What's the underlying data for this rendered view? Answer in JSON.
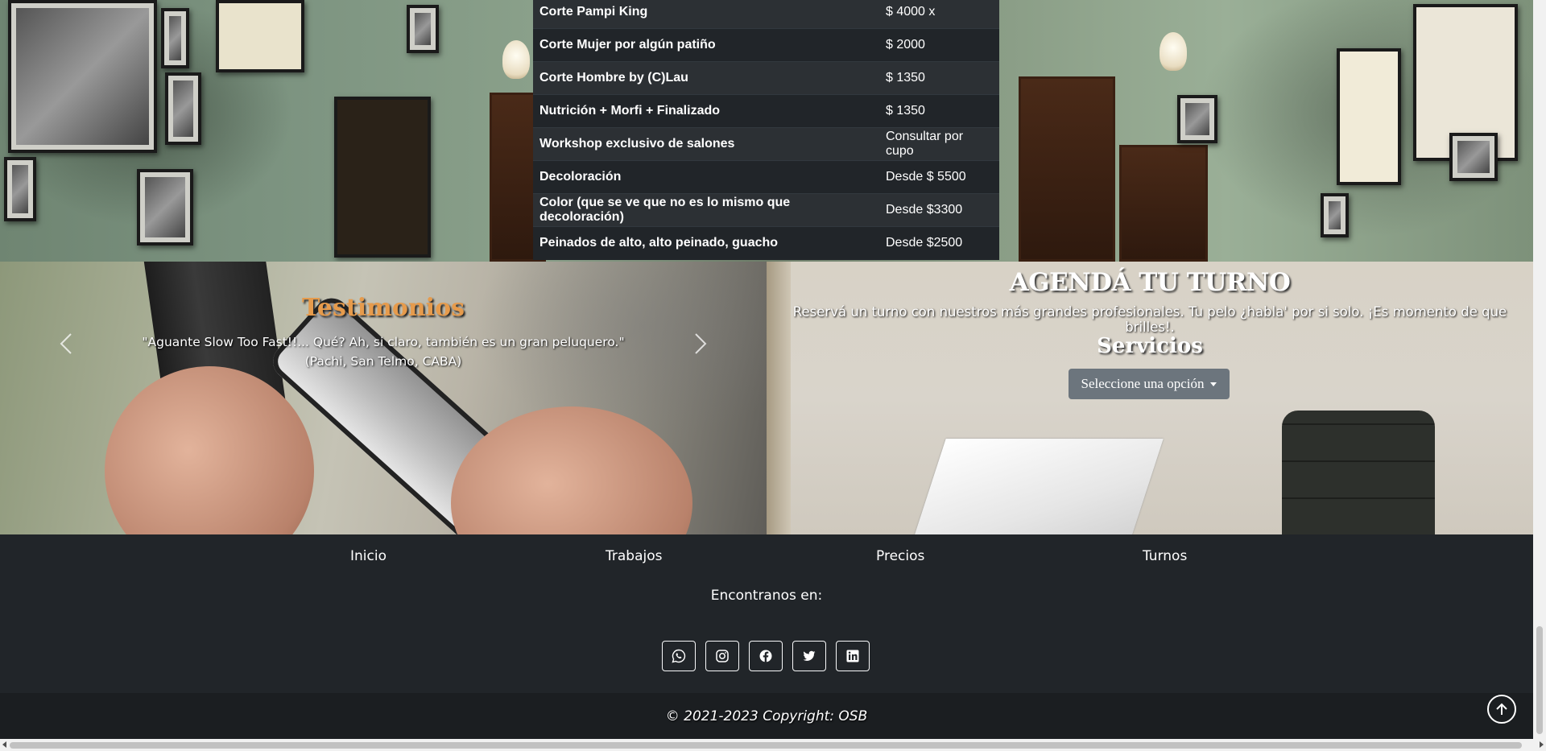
{
  "prices": {
    "rows": [
      {
        "name": "Corte Pampi King",
        "price": "$ 4000 x"
      },
      {
        "name": "Corte Mujer por algún patiño",
        "price": "$ 2000"
      },
      {
        "name": "Corte Hombre by (C)Lau",
        "price": "$ 1350"
      },
      {
        "name": "Nutrición + Morfi + Finalizado",
        "price": "$ 1350"
      },
      {
        "name": "Workshop exclusivo de salones",
        "price": "Consultar por cupo"
      },
      {
        "name": "Decoloración",
        "price": "Desde $ 5500"
      },
      {
        "name": "Color (que se ve que no es lo mismo que decoloración)",
        "price": "Desde $3300"
      },
      {
        "name": "Peinados de alto, alto peinado, guacho",
        "price": "Desde $2500"
      }
    ]
  },
  "testimonials": {
    "title": "Testimonios",
    "quote": "\"Aguante Slow Too Fast!!... Qué? Ah, si claro, también es un gran peluquero.\"",
    "author": "(Pachi, San Telmo, CABA)",
    "prev_icon": "chevron-left-icon",
    "next_icon": "chevron-right-icon",
    "title_color": "#e69b4c"
  },
  "booking": {
    "title": "AGENDÁ TU TURNO",
    "text": "Reservá un turno con nuestros más grandes profesionales. Tu pelo ¿habla' por si solo. ¡Es momento de que brilles!.",
    "services_title": "Servicios",
    "select_label": "Seleccione una opción",
    "select_color": "#6c757d"
  },
  "footer": {
    "nav": [
      "Inicio",
      "Trabajos",
      "Precios",
      "Turnos"
    ],
    "find_us": "Encontranos en:",
    "socials": [
      "whatsapp-icon",
      "instagram-icon",
      "facebook-icon",
      "twitter-icon",
      "linkedin-icon"
    ],
    "copyright": "© 2021-2023 Copyright: OSB",
    "background": "#212529"
  }
}
